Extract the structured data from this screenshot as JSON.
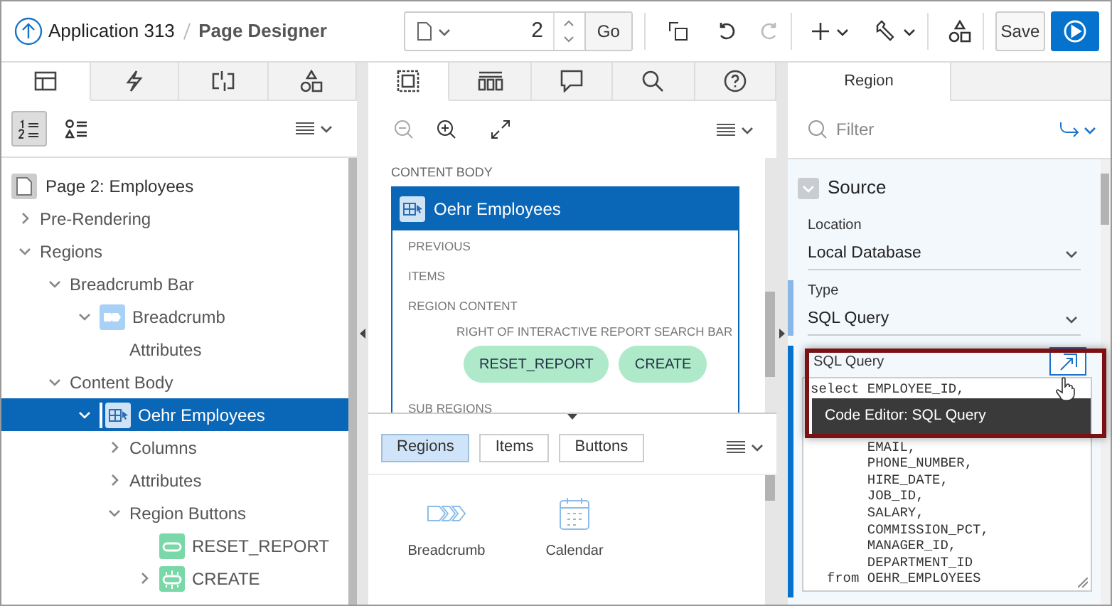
{
  "header": {
    "app": "Application 313",
    "page": "Page Designer",
    "page_number": "2",
    "go": "Go",
    "save": "Save"
  },
  "left_tabs": [
    {
      "selected": true
    },
    {
      "selected": false
    },
    {
      "selected": false
    },
    {
      "selected": false
    }
  ],
  "left_toolbar": [
    {
      "selected": true
    },
    {
      "selected": false
    }
  ],
  "tree": {
    "label": "Page 2: Employees",
    "children": [
      {
        "label": "Pre-Rendering",
        "expanded": false
      },
      {
        "label": "Regions",
        "expanded": true,
        "children": [
          {
            "label": "Breadcrumb Bar",
            "expanded": true,
            "children": [
              {
                "label": "Breadcrumb",
                "kind": "breadcrumb",
                "expanded": true,
                "selected": false,
                "children": [
                  {
                    "label": "Attributes"
                  }
                ]
              }
            ]
          },
          {
            "label": "Content Body",
            "expanded": true,
            "children": [
              {
                "label": "Oehr Employees",
                "kind": "report",
                "expanded": true,
                "selected": true,
                "children": [
                  {
                    "label": "Columns",
                    "expanded": false
                  },
                  {
                    "label": "Attributes",
                    "expanded": false
                  },
                  {
                    "label": "Region Buttons",
                    "expanded": true,
                    "children": [
                      {
                        "label": "RESET_REPORT",
                        "kind": "button"
                      },
                      {
                        "label": "CREATE",
                        "kind": "button-dashed",
                        "expanded": false
                      }
                    ]
                  }
                ]
              }
            ]
          }
        ]
      }
    ]
  },
  "middle_tabs": [
    {
      "selected": true
    },
    {
      "selected": false
    },
    {
      "selected": false
    },
    {
      "selected": false
    },
    {
      "selected": false
    }
  ],
  "layout": {
    "section": "CONTENT BODY",
    "region": "Oehr Employees",
    "slots": [
      "PREVIOUS",
      "ITEMS",
      "REGION CONTENT"
    ],
    "button_slot": "RIGHT OF INTERACTIVE REPORT SEARCH BAR",
    "buttons": [
      "RESET_REPORT",
      "CREATE"
    ],
    "sub": "SUB REGIONS"
  },
  "gallery": {
    "tabs": [
      {
        "label": "Regions",
        "selected": true
      },
      {
        "label": "Items",
        "selected": false
      },
      {
        "label": "Buttons",
        "selected": false
      }
    ],
    "items": [
      {
        "label": "Breadcrumb"
      },
      {
        "label": "Calendar"
      }
    ]
  },
  "property_editor": {
    "tab": "Region",
    "filter_placeholder": "Filter",
    "group": "Source",
    "fields": [
      {
        "label": "Location",
        "value": "Local Database"
      },
      {
        "label": "Type",
        "value": "SQL Query"
      }
    ],
    "sql_label": "SQL Query",
    "code_top": [
      "select EMPLOYEE_ID,"
    ],
    "code_rest": [
      "       EMAIL,",
      "       PHONE_NUMBER,",
      "       HIRE_DATE,",
      "       JOB_ID,",
      "       SALARY,",
      "       COMMISSION_PCT,",
      "       MANAGER_ID,",
      "       DEPARTMENT_ID",
      "  from OEHR_EMPLOYEES"
    ],
    "tooltip": "Code Editor: SQL Query"
  }
}
